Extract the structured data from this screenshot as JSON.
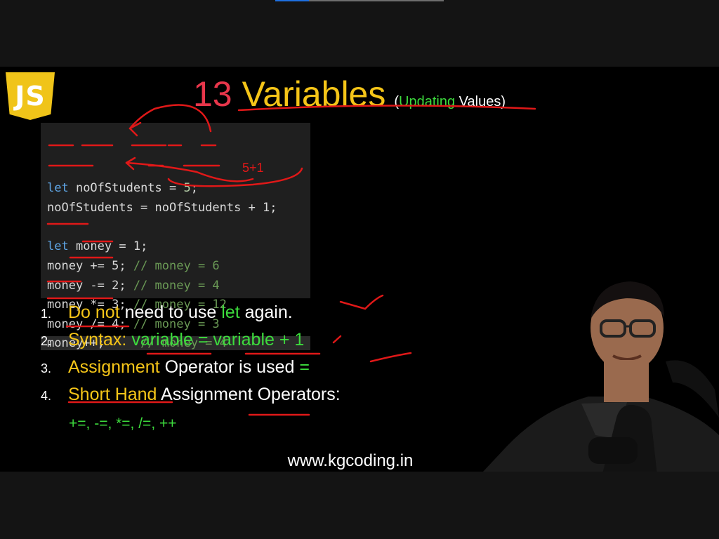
{
  "player": {
    "progress": 0.2
  },
  "slide": {
    "logo": "JS",
    "title": {
      "number": "13",
      "main": "Variables",
      "paren_open": "(",
      "paren_green": "Updating",
      "paren_rest": " Values)"
    },
    "code": {
      "line1": {
        "kw": "let",
        "rest": " noOfStudents = ",
        "num": "5",
        "end": ";"
      },
      "line2": {
        "text": "noOfStudents = noOfStudents + 1;"
      },
      "line3": {
        "kw": "let",
        "rest": " money = 1;"
      },
      "line4": {
        "code": "money += 5;",
        "comment": " // money = 6"
      },
      "line5": {
        "code": "money -= 2;",
        "comment": " // money = 4"
      },
      "line6": {
        "code": "money *= 3;",
        "comment": " // money = 12"
      },
      "line7": {
        "code": "money /= 4;",
        "comment": " // money = 3"
      },
      "line8": {
        "code": "money++;",
        "comment": "     // money = 4"
      }
    },
    "annotation": "5+1",
    "points": [
      {
        "num": "1.",
        "a": "Do not",
        "b": " need to use ",
        "c": "let",
        "d": " again."
      },
      {
        "num": "2.",
        "a": "Syntax: ",
        "b": "variable = variable + 1"
      },
      {
        "num": "3.",
        "a": "Assignment",
        "b": " Operator is used ",
        "c": "="
      },
      {
        "num": "4.",
        "a": "Short Hand",
        "b": " Assignment Operators:"
      }
    ],
    "operators": "+=, -=, *=, /=, ++",
    "url": "www.kgcoding.in"
  },
  "colors": {
    "title_number": "#e8364b",
    "highlight": "#f5c518",
    "green": "#3ddc3d",
    "ink": "#e01818",
    "keyword": "#5fa6e6"
  },
  "icons": [
    "js-logo-icon"
  ]
}
